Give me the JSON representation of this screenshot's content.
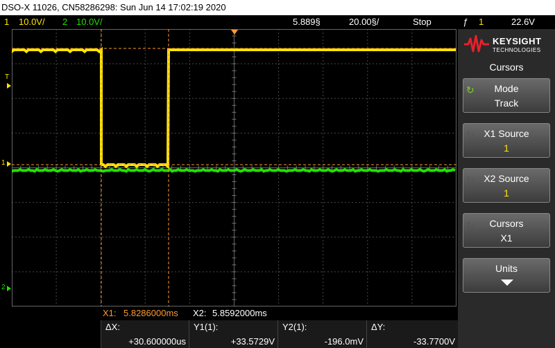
{
  "title": "DSO-X 11026, CN58286298: Sun Jun 14 17:02:19 2020",
  "status": {
    "ch1_num": "1",
    "ch1_scale": "10.0V/",
    "ch2_num": "2",
    "ch2_scale": "10.0V/",
    "time_offset": "5.889§",
    "time_scale": "20.00§/",
    "run_state": "Stop",
    "trigger_icon": "ƒ",
    "trigger_channel": "1",
    "trigger_level": "22.6V"
  },
  "markers": {
    "trigger_level": "T",
    "ch1_ground": "1",
    "ch2_ground": "2"
  },
  "cursors": {
    "x1_label": "X1:",
    "x1_value": "5.8286000ms",
    "x2_label": "X2:",
    "x2_value": "5.8592000ms",
    "dx_label": "ΔX:",
    "dx_value": "+30.600000us",
    "y1_label": "Y1(1):",
    "y1_value": "+33.5729V",
    "y2_label": "Y2(1):",
    "y2_value": "-196.0mV",
    "dy_label": "ΔY:",
    "dy_value": "-33.7700V"
  },
  "panel": {
    "brand": "KEYSIGHT",
    "brand_sub": "TECHNOLOGIES",
    "menu_title": "Cursors",
    "keys": [
      {
        "line1": "Mode",
        "line2": "Track"
      },
      {
        "line1": "X1 Source",
        "line2": "1"
      },
      {
        "line1": "X2 Source",
        "line2": "1"
      },
      {
        "line1": "Cursors",
        "line2": "X1"
      },
      {
        "line1": "Units",
        "line2": ""
      }
    ]
  },
  "colors": {
    "ch1": "#ffe600",
    "ch2": "#22e000",
    "cursor": "#ff9a2e",
    "grid": "#555555"
  },
  "icons": [
    "keysight-logo-icon",
    "rotate-knob-icon",
    "down-arrow-icon",
    "trigger-edge-icon"
  ]
}
